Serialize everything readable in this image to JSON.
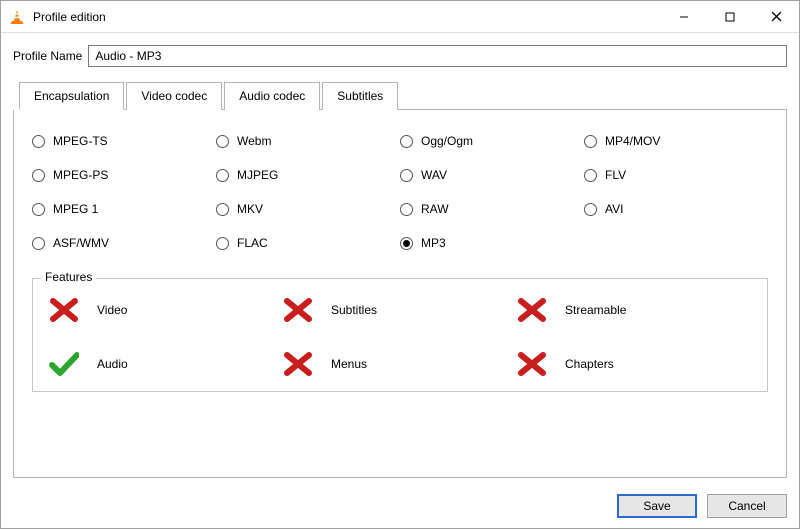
{
  "window": {
    "title": "Profile edition"
  },
  "profile": {
    "name_label": "Profile Name",
    "name_value": "Audio - MP3"
  },
  "tabs": [
    {
      "id": "encapsulation",
      "label": "Encapsulation",
      "active": true
    },
    {
      "id": "video-codec",
      "label": "Video codec",
      "active": false
    },
    {
      "id": "audio-codec",
      "label": "Audio codec",
      "active": false
    },
    {
      "id": "subtitles",
      "label": "Subtitles",
      "active": false
    }
  ],
  "encapsulation": {
    "options": [
      {
        "label": "MPEG-TS",
        "selected": false
      },
      {
        "label": "Webm",
        "selected": false
      },
      {
        "label": "Ogg/Ogm",
        "selected": false
      },
      {
        "label": "MP4/MOV",
        "selected": false
      },
      {
        "label": "MPEG-PS",
        "selected": false
      },
      {
        "label": "MJPEG",
        "selected": false
      },
      {
        "label": "WAV",
        "selected": false
      },
      {
        "label": "FLV",
        "selected": false
      },
      {
        "label": "MPEG 1",
        "selected": false
      },
      {
        "label": "MKV",
        "selected": false
      },
      {
        "label": "RAW",
        "selected": false
      },
      {
        "label": "AVI",
        "selected": false
      },
      {
        "label": "ASF/WMV",
        "selected": false
      },
      {
        "label": "FLAC",
        "selected": false
      },
      {
        "label": "MP3",
        "selected": true
      }
    ]
  },
  "features": {
    "legend": "Features",
    "items": [
      {
        "label": "Video",
        "ok": false
      },
      {
        "label": "Subtitles",
        "ok": false
      },
      {
        "label": "Streamable",
        "ok": false
      },
      {
        "label": "Audio",
        "ok": true
      },
      {
        "label": "Menus",
        "ok": false
      },
      {
        "label": "Chapters",
        "ok": false
      }
    ]
  },
  "buttons": {
    "save": "Save",
    "cancel": "Cancel"
  }
}
